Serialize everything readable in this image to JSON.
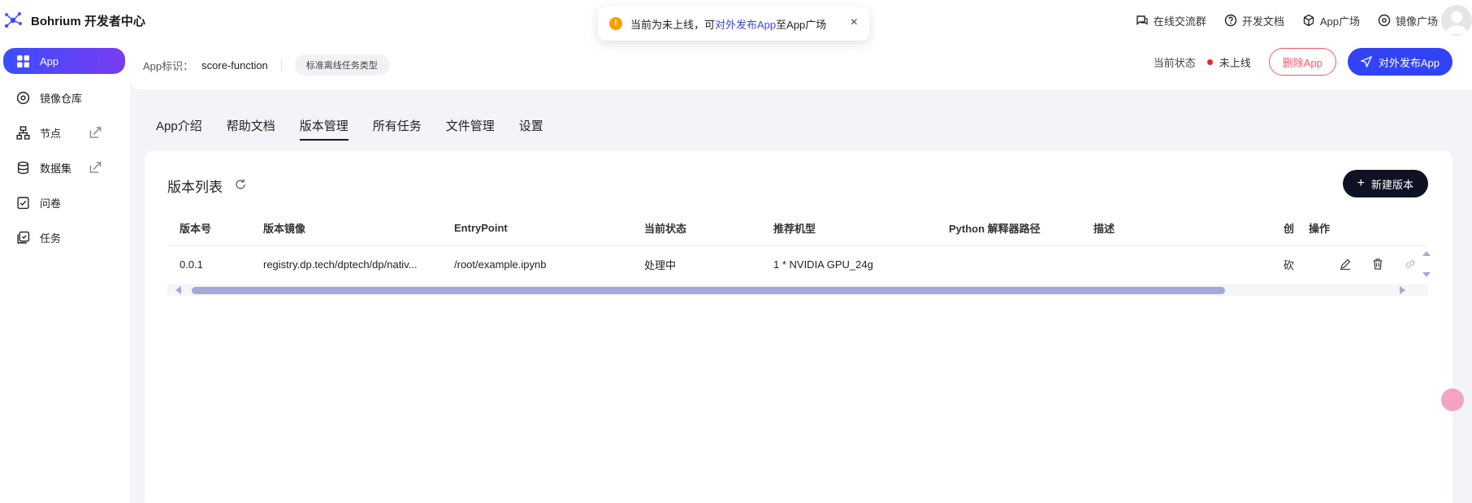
{
  "brand": {
    "name": "Bohrium 开发者中心"
  },
  "toast": {
    "text_before": "当前为未上线，可",
    "link": "对外发布App",
    "text_after": "至App广场",
    "close": "×"
  },
  "top_links": [
    {
      "label": "在线交流群",
      "icon": "chat-icon"
    },
    {
      "label": "开发文档",
      "icon": "help-icon"
    },
    {
      "label": "App广场",
      "icon": "cube-icon"
    },
    {
      "label": "镜像广场",
      "icon": "disc-icon"
    }
  ],
  "sidebar": {
    "items": [
      {
        "label": "App",
        "icon": "grid-icon",
        "active": true
      },
      {
        "label": "镜像仓库",
        "icon": "disc-icon"
      },
      {
        "label": "节点",
        "icon": "node-icon",
        "external": true
      },
      {
        "label": "数据集",
        "icon": "database-icon",
        "external": true
      },
      {
        "label": "问卷",
        "icon": "survey-icon"
      },
      {
        "label": "任务",
        "icon": "task-icon"
      }
    ]
  },
  "app": {
    "id_label": "App标识：",
    "id_value": "score-function",
    "type": "标准离线任务类型",
    "status_label": "当前状态",
    "status_value": "未上线",
    "status_color": "#f5222d",
    "delete_label": "删除App",
    "publish_label": "对外发布App"
  },
  "tabs": [
    "App介绍",
    "帮助文档",
    "版本管理",
    "所有任务",
    "文件管理",
    "设置"
  ],
  "active_tab": "版本管理",
  "versions": {
    "title": "版本列表",
    "new_label": "新建版本",
    "columns": [
      "版本号",
      "版本镜像",
      "EntryPoint",
      "当前状态",
      "推荐机型",
      "Python 解释器路径",
      "描述",
      "创",
      "操作"
    ],
    "rows": [
      {
        "version": "0.0.1",
        "image": "registry.dp.tech/dptech/dp/nativ...",
        "entrypoint": "/root/example.ipynb",
        "status": "处理中",
        "machine": "1 * NVIDIA GPU_24g",
        "python_path": "",
        "description": "",
        "created": "砍"
      }
    ]
  },
  "colors": {
    "accent": "#3243f5",
    "danger": "#f5576c",
    "dark_button": "#0f1222",
    "scrollbar": "#a6a8d8"
  }
}
